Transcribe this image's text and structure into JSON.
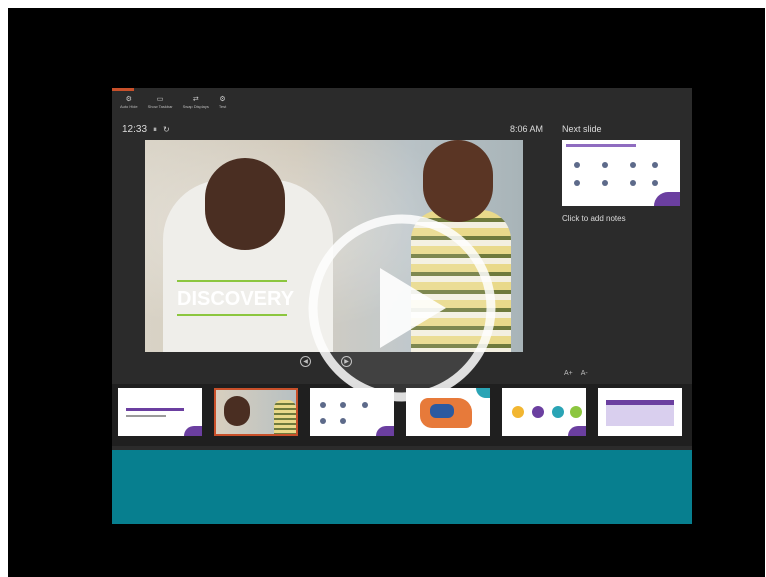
{
  "toolbar": {
    "items": [
      {
        "label": "Auto Hide",
        "icon": "gear-icon"
      },
      {
        "label": "Show Taskbar",
        "icon": "taskbar-icon"
      },
      {
        "label": "Swap Displays",
        "icon": "swap-icon"
      },
      {
        "label": "Test",
        "icon": "gear-icon"
      }
    ]
  },
  "presenter": {
    "timer": "12:33",
    "clock": "8:06 AM",
    "next_slide_label": "Next slide",
    "notes_placeholder": "Click to add notes",
    "current_slide_title": "DISCOVERY"
  },
  "colors": {
    "accent": "#c8502a",
    "teal": "#077f8f",
    "purple": "#6b3fa0",
    "green": "#8cc63f"
  }
}
